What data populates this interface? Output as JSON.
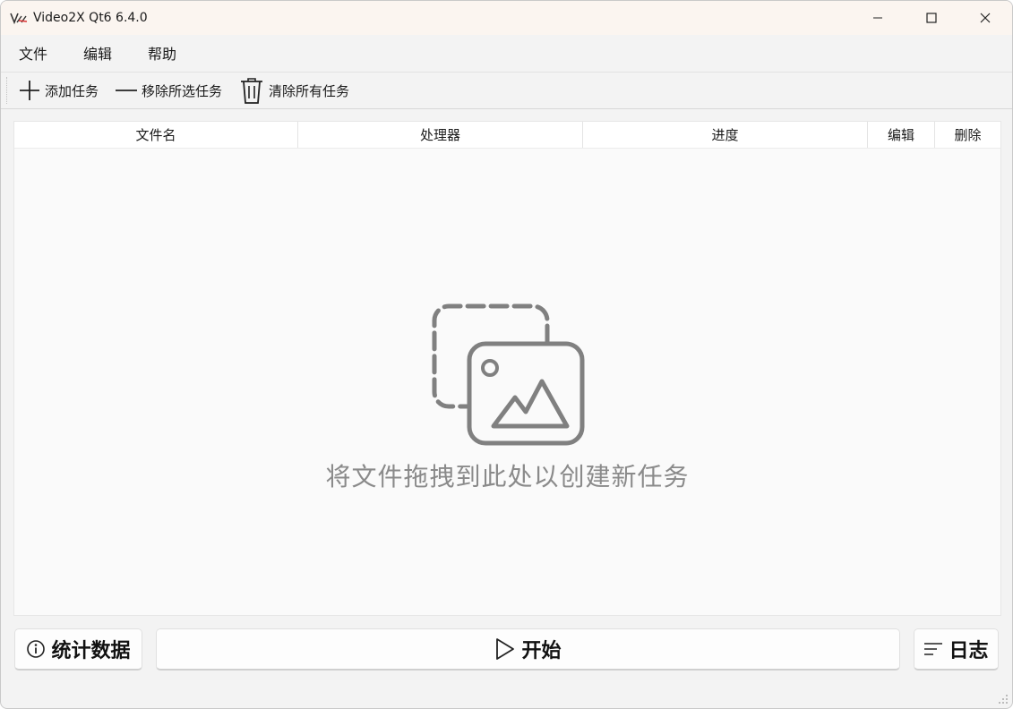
{
  "window": {
    "title": "Video2X Qt6 6.4.0",
    "controls": [
      "minimize-icon",
      "maximize-icon",
      "close-icon"
    ]
  },
  "menu": {
    "items": [
      "文件",
      "编辑",
      "帮助"
    ]
  },
  "toolbar": {
    "add_label": "添加任务",
    "remove_label": "移除所选任务",
    "clear_label": "清除所有任务"
  },
  "table": {
    "columns": [
      "文件名",
      "处理器",
      "进度",
      "编辑",
      "删除"
    ]
  },
  "placeholder": {
    "icon": "image-placeholder-icon",
    "text": "将文件拖拽到此处以创建新任务"
  },
  "bottom": {
    "stats_label": "统计数据",
    "start_label": "开始",
    "log_label": "日志"
  },
  "colors": {
    "titlebar_bg": "#fbf5f0",
    "window_bg": "#f3f3f3",
    "placeholder_gray": "#808080"
  }
}
